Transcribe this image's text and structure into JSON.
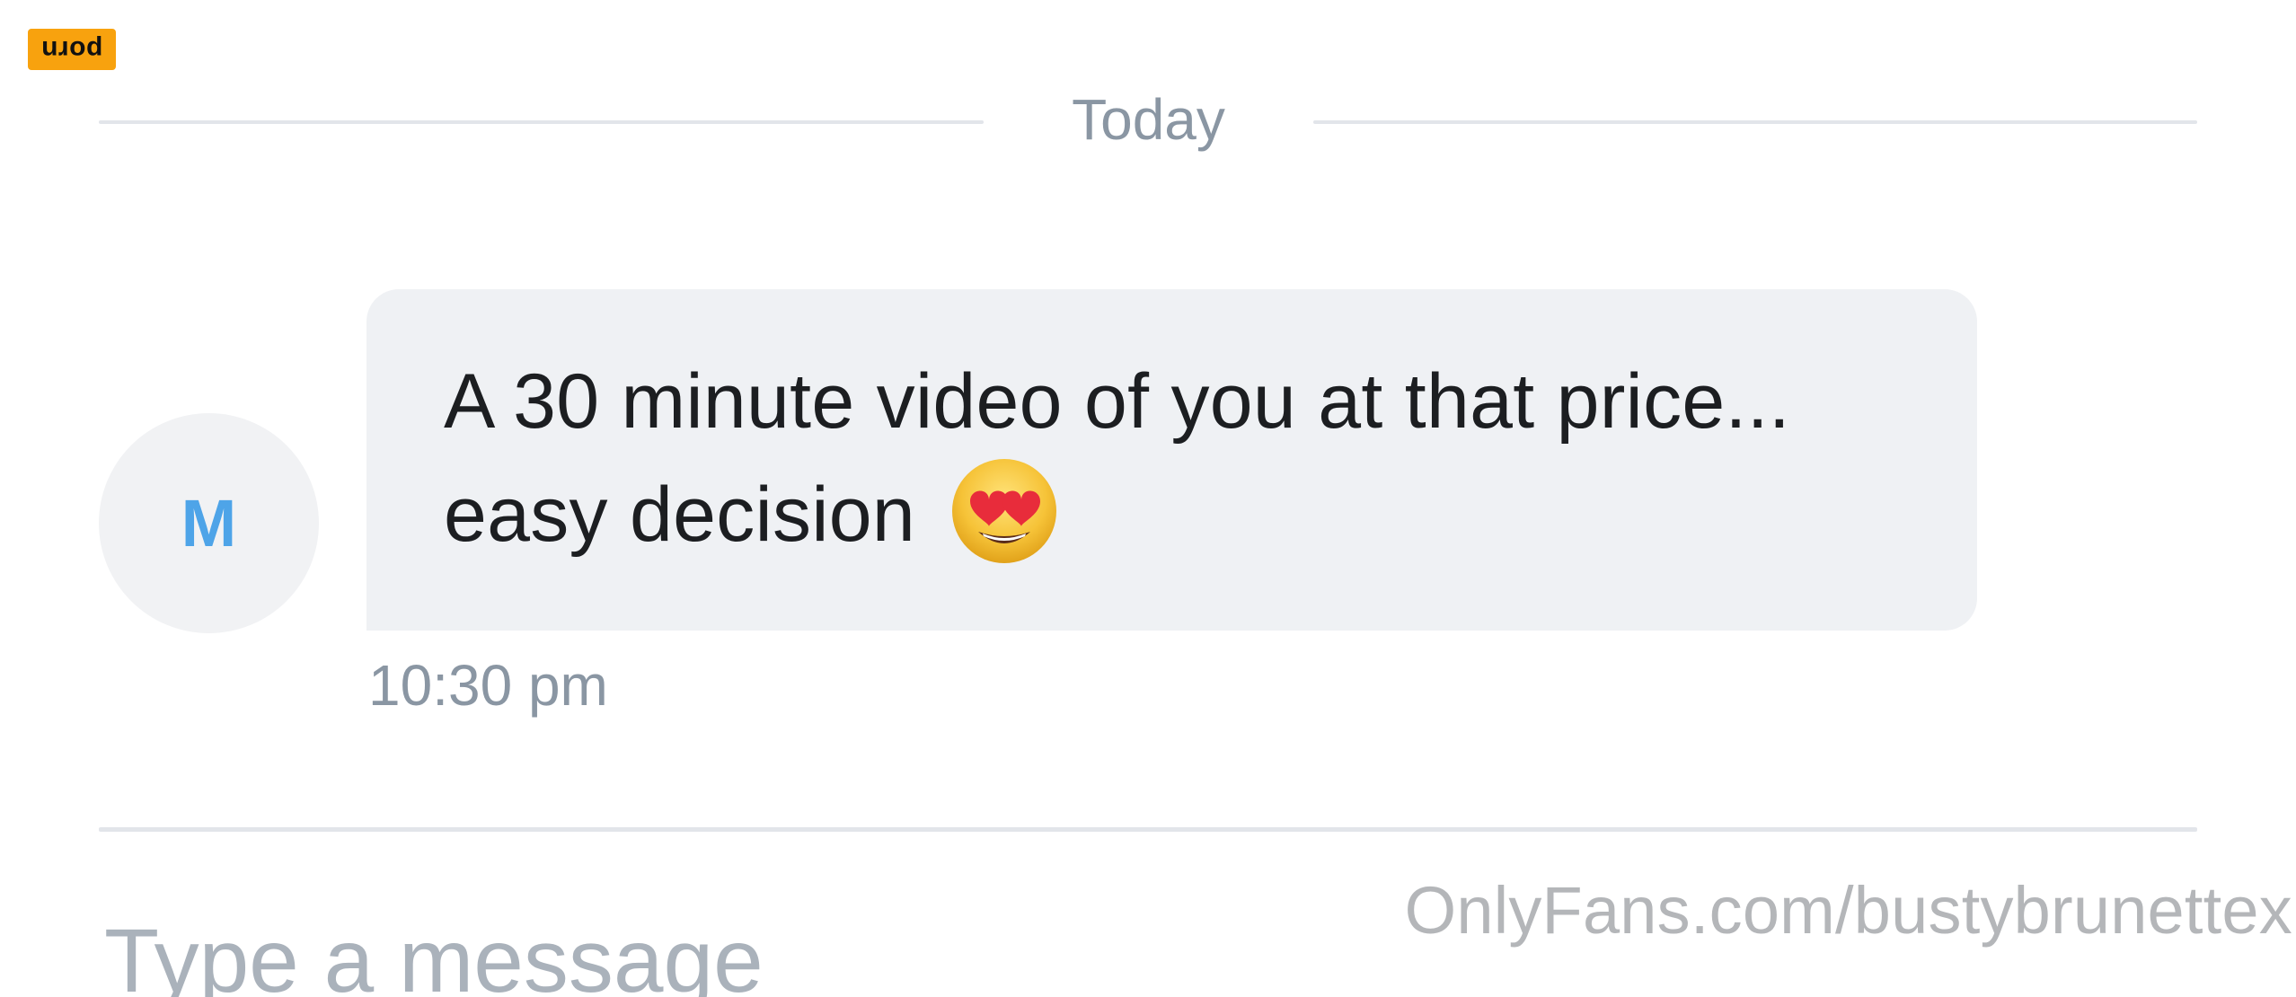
{
  "corner_badge": {
    "text": "porn"
  },
  "date_divider": {
    "label": "Today"
  },
  "message": {
    "sender_initial": "M",
    "text": "A 30 minute video of you at that price... easy decision",
    "emoji": "smiling-face-with-heart-eyes",
    "timestamp": "10:30 pm"
  },
  "composer": {
    "placeholder": "Type a message"
  },
  "watermark": {
    "text": "OnlyFans.com/bustybrunettex"
  },
  "colors": {
    "badge_bg": "#f8a20e",
    "bubble_bg": "#eff1f4",
    "avatar_text": "#4ea4e8",
    "muted_text": "#8a96a3",
    "divider": "#e2e5ea"
  }
}
